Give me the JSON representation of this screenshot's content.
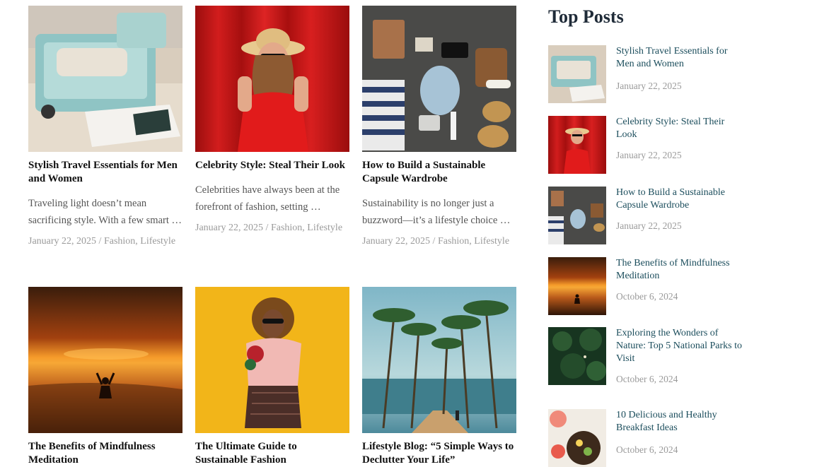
{
  "posts": [
    {
      "title": "Stylish Travel Essentials for Men and Women",
      "excerpt": "Traveling light doesn’t mean sacrificing style. With a few smart …",
      "date": "January 22, 2025",
      "separator": " / ",
      "cat1": "Fashion",
      "comma": ", ",
      "cat2": "Lifestyle",
      "image": "suitcase-photo"
    },
    {
      "title": "Celebrity Style: Steal Their Look",
      "excerpt": "Celebrities have always been at the forefront of fashion, setting …",
      "date": "January 22, 2025",
      "separator": " / ",
      "cat1": "Fashion",
      "comma": ", ",
      "cat2": "Lifestyle",
      "image": "woman-red-curtain-photo"
    },
    {
      "title": "How to Build a Sustainable Capsule Wardrobe",
      "excerpt": "Sustainability is no longer just a buzzword—it’s a lifestyle choice …",
      "date": "January 22, 2025",
      "separator": " / ",
      "cat1": "Fashion",
      "comma": ", ",
      "cat2": "Lifestyle",
      "image": "flatlay-photo"
    },
    {
      "title": "The Benefits of Mindfulness Meditation",
      "image": "sunset-meditation-photo"
    },
    {
      "title": "The Ultimate Guide to Sustainable Fashion",
      "image": "woman-yellow-photo"
    },
    {
      "title": "Lifestyle Blog: “5 Simple Ways to Declutter Your Life”",
      "image": "palm-trees-photo"
    }
  ],
  "sidebar": {
    "heading": "Top Posts",
    "items": [
      {
        "title": "Stylish Travel Essentials for Men and Women",
        "date": "January 22, 2025"
      },
      {
        "title": "Celebrity Style: Steal Their Look",
        "date": "January 22, 2025"
      },
      {
        "title": "How to Build a Sustainable Capsule Wardrobe",
        "date": "January 22, 2025"
      },
      {
        "title": "The Benefits of Mindfulness Meditation",
        "date": "October 6, 2024"
      },
      {
        "title": "Exploring the Wonders of Nature: Top 5 National Parks to Visit",
        "date": "October 6, 2024"
      },
      {
        "title": "10 Delicious and Healthy Breakfast Ideas",
        "date": "October 6, 2024"
      }
    ]
  },
  "colors": {
    "link": "#1b4d5c",
    "meta": "#9a9a9a",
    "heading": "#1f2b38"
  }
}
